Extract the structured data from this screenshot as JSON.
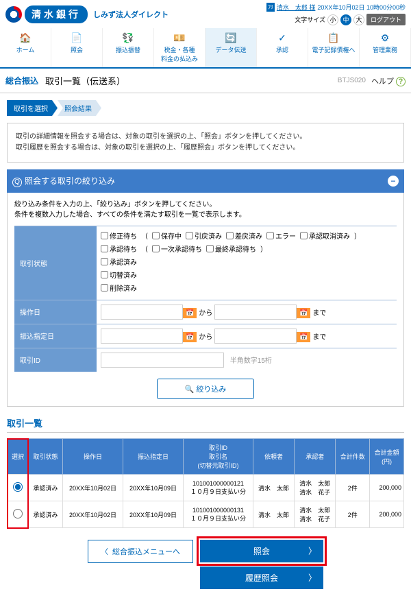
{
  "header": {
    "bank_name": "清水銀行",
    "subtitle": "しみず法人ダイレクト",
    "user_badge": "ﾌﾘ",
    "user_name": "清水　太郎 様",
    "datetime": "20XX年10月02日 10時00分00秒",
    "font_label": "文字サイズ",
    "size_s": "小",
    "size_m": "中",
    "size_l": "大",
    "logout": "ログアウト"
  },
  "nav": {
    "items": [
      {
        "label": "ホーム",
        "icon": "🏠"
      },
      {
        "label": "照会",
        "icon": "📄"
      },
      {
        "label": "振込振替",
        "icon": "💱"
      },
      {
        "label": "税金・各種\n料金の払込み",
        "icon": "💴"
      },
      {
        "label": "データ伝送",
        "icon": "🔄"
      },
      {
        "label": "承認",
        "icon": "✓"
      },
      {
        "label": "電子記録債権へ",
        "icon": "📋"
      },
      {
        "label": "管理業務",
        "icon": "⚙"
      }
    ]
  },
  "page": {
    "category": "総合振込",
    "title": "取引一覧（伝送系）",
    "id": "BTJS020",
    "help": "ヘルプ"
  },
  "steps": {
    "s1": "取引を選択",
    "s2": "照会結果"
  },
  "intro": {
    "l1": "取引の詳細情報を照会する場合は、対象の取引を選択の上、「照会」ボタンを押してください。",
    "l2": "取引履歴を照会する場合は、対象の取引を選択の上、「履歴照会」ボタンを押してください。"
  },
  "filter": {
    "title": "照会する取引の絞り込み",
    "desc1": "絞り込み条件を入力の上、「絞り込み」ボタンを押してください。",
    "desc2": "条件を複数入力した場合、すべての条件を満たす取引を一覧で表示します。",
    "row_status": "取引状態",
    "row_op_date": "操作日",
    "row_spec_date": "振込指定日",
    "row_id": "取引ID",
    "statuses_l1": [
      "修正待ち",
      "（",
      "保存中",
      "引戻済み",
      "差戻済み",
      "エラー",
      "承認取消済み",
      "）"
    ],
    "statuses_l2": [
      "承認待ち",
      "（",
      "一次承認待ち",
      "最終承認待ち",
      "）"
    ],
    "statuses_l3": "承認済み",
    "statuses_l4": "切替済み",
    "statuses_l5": "削除済み",
    "from": "から",
    "to": "まで",
    "id_hint": "半角数字15桁",
    "btn": "絞り込み"
  },
  "list": {
    "title": "取引一覧",
    "cols": {
      "sel": "選択",
      "status": "取引状態",
      "op": "操作日",
      "spec": "振込指定日",
      "id": "取引ID\n取引名\n(切替元取引ID)",
      "req": "依頼者",
      "apr": "承認者",
      "cnt": "合計件数",
      "amt": "合計金額\n(円)"
    },
    "rows": [
      {
        "status": "承認済み",
        "op": "20XX年10月02日",
        "spec": "20XX年10月09日",
        "id": "101001000000121\n１０月９日支払い分",
        "req": "清水　太郎",
        "apr": "清水　太郎\n清水　花子",
        "cnt": "2件",
        "amt": "200,000"
      },
      {
        "status": "承認済み",
        "op": "20XX年10月02日",
        "spec": "20XX年10月09日",
        "id": "101001000000131\n１０月９日支払い分",
        "req": "清水　太郎",
        "apr": "清水　太郎\n清水　花子",
        "cnt": "2件",
        "amt": "200,000"
      }
    ]
  },
  "actions": {
    "back": "総合振込メニューへ",
    "query": "照会",
    "history": "履歴照会"
  }
}
